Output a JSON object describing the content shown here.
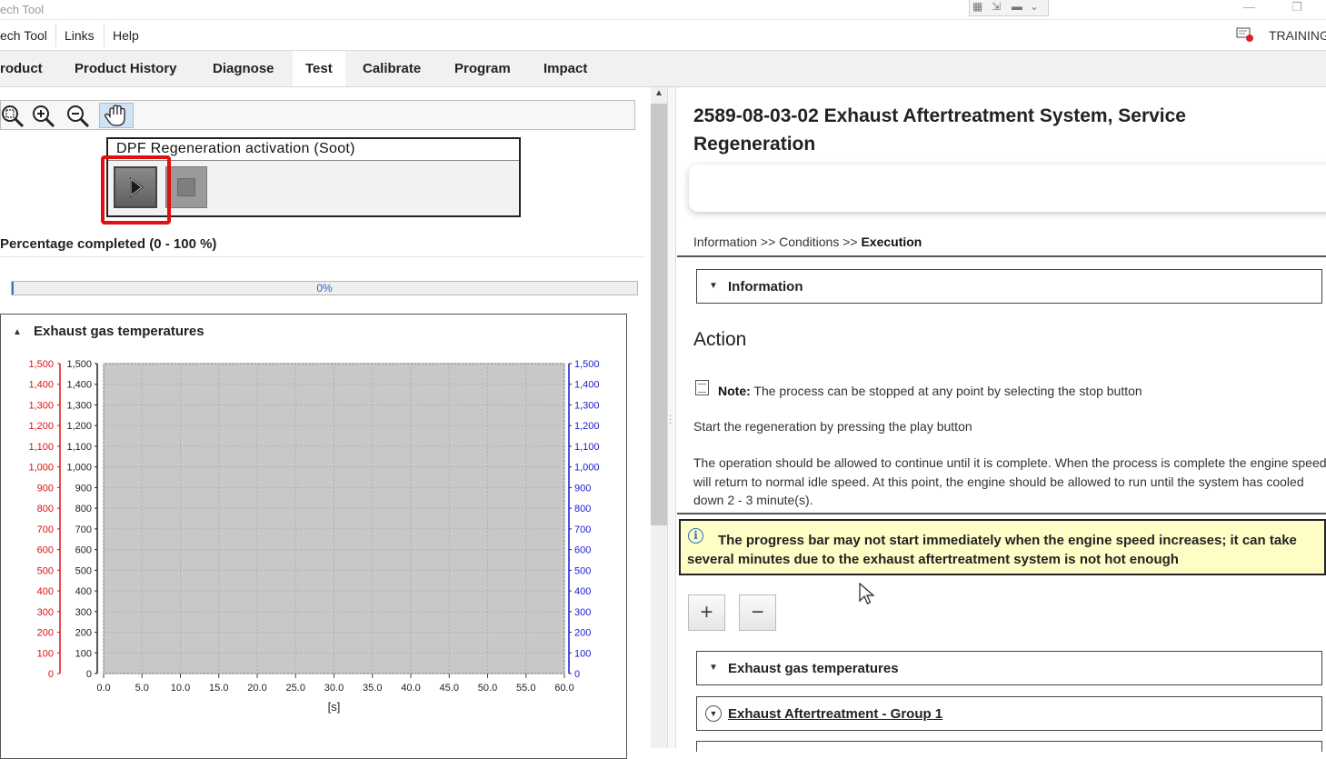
{
  "window": {
    "title": "ech Tool"
  },
  "menu": {
    "items": [
      "ech Tool",
      "Links",
      "Help"
    ],
    "user": "TRAINING"
  },
  "nav_tabs": [
    "roduct",
    "Product History",
    "Diagnose",
    "Test",
    "Calibrate",
    "Program",
    "Impact"
  ],
  "active_tab": "Test",
  "toolbar": {
    "tools": [
      "zoom-fit-icon",
      "zoom-in-icon",
      "zoom-out-icon",
      "pan-hand-icon"
    ],
    "active_tool": "pan-hand-icon"
  },
  "test_box": {
    "title": "DPF Regeneration activation (Soot)"
  },
  "progress": {
    "label": "Percentage completed (0 - 100 %)",
    "value_text": "0%",
    "value": 0
  },
  "chart_panel": {
    "title": "Exhaust gas temperatures"
  },
  "chart_data": {
    "type": "line",
    "title": "Exhaust gas temperatures",
    "xlabel": "[s]",
    "xlim": [
      0,
      60
    ],
    "x_ticks": [
      "0.0",
      "5.0",
      "10.0",
      "15.0",
      "20.0",
      "25.0",
      "30.0",
      "35.0",
      "40.0",
      "45.0",
      "50.0",
      "55.0",
      "60.0"
    ],
    "y_axes": [
      {
        "side": "left-outer",
        "color": "#e01010",
        "ticks": [
          "1,500",
          "1,400",
          "1,300",
          "1,200",
          "1,100",
          "1,000",
          "900",
          "800",
          "700",
          "600",
          "500",
          "400",
          "300",
          "200",
          "100",
          "0"
        ]
      },
      {
        "side": "left-inner",
        "color": "#222222",
        "ticks": [
          "1,500",
          "1,400",
          "1,300",
          "1,200",
          "1,100",
          "1,000",
          "900",
          "800",
          "700",
          "600",
          "500",
          "400",
          "300",
          "200",
          "100",
          "0"
        ]
      },
      {
        "side": "right",
        "color": "#1a1acc",
        "ticks": [
          "1,500",
          "1,400",
          "1,300",
          "1,200",
          "1,100",
          "1,000",
          "900",
          "800",
          "700",
          "600",
          "500",
          "400",
          "300",
          "200",
          "100",
          "0"
        ]
      }
    ],
    "ylim": [
      0,
      1500
    ],
    "grid": true,
    "plot_background": "#c8c8c8",
    "series": []
  },
  "document": {
    "title": "2589-08-03-02 Exhaust Aftertreatment System, Service Regeneration",
    "breadcrumb": {
      "part1": "Information >> Conditions >> ",
      "current": "Execution"
    },
    "information_label": "Information",
    "action_heading": "Action",
    "note_label": "Note:",
    "note_text": " The process can be stopped at any point by selecting the stop button",
    "start_text": "Start the regeneration by pressing the play button",
    "operation_text": "The operation should be allowed to continue until it is complete. When the process is complete the engine speed will return to normal idle speed. At this point, the engine should be allowed to run until the system has cooled down 2 - 3 minute(s).",
    "warning_text": "The progress bar may not start immediately when the engine speed increases; it can take several minutes due to the exhaust aftertreatment system is not hot enough",
    "zoom_in_label": "+",
    "zoom_out_label": "−",
    "section_exhaust": "Exhaust gas temperatures",
    "section_group": "Exhaust Aftertreatment - Group 1"
  },
  "colors": {
    "highlight": "#e01010",
    "warning_bg": "#fffdc6",
    "progress": "#2f7bd4"
  }
}
